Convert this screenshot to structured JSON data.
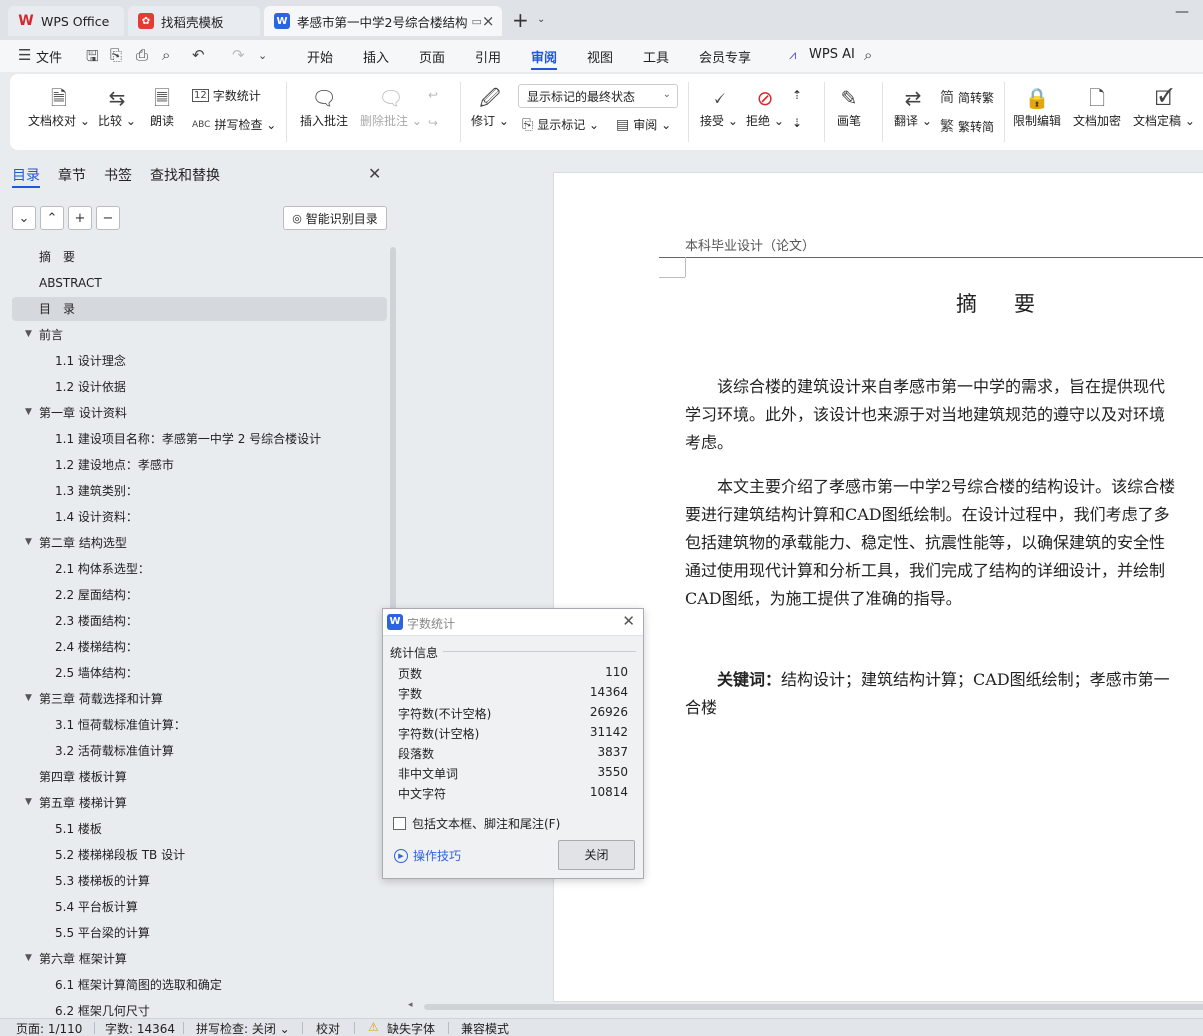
{
  "tabs": {
    "wps": "WPS Office",
    "template": "找稻壳模板",
    "doc": "孝感市第一中学2号综合楼结构"
  },
  "menubar": {
    "file": "文件",
    "items": [
      "开始",
      "插入",
      "页面",
      "引用",
      "审阅",
      "视图",
      "工具",
      "会员专享"
    ],
    "wps_ai": "WPS AI"
  },
  "ribbon": {
    "doc_check": "文档校对",
    "compare": "比较",
    "read_aloud": "朗读",
    "word_count": "字数统计",
    "spell_check": "拼写检查",
    "insert_comment": "插入批注",
    "delete_comment": "删除批注",
    "revise": "修订",
    "markup_select": "显示标记的最终状态",
    "show_markup": "显示标记",
    "review": "审阅",
    "accept": "接受",
    "reject": "拒绝",
    "pen": "画笔",
    "translate": "翻译",
    "to_trad": "简转繁",
    "to_simp": "繁转简",
    "restrict_edit": "限制编辑",
    "encrypt": "文档加密",
    "finalize": "文档定稿"
  },
  "panel": {
    "tabs": [
      "目录",
      "章节",
      "书签",
      "查找和替换"
    ],
    "smart_toc": "智能识别目录",
    "toc": [
      {
        "text": "摘　要",
        "level": 1,
        "expand": false,
        "selected": false
      },
      {
        "text": "ABSTRACT",
        "level": 1,
        "expand": false,
        "selected": false
      },
      {
        "text": "目　录",
        "level": 1,
        "expand": false,
        "selected": true
      },
      {
        "text": "前言",
        "level": 1,
        "expand": true,
        "selected": false
      },
      {
        "text": "1.1 设计理念",
        "level": 2,
        "expand": false,
        "selected": false
      },
      {
        "text": "1.2 设计依据",
        "level": 2,
        "expand": false,
        "selected": false
      },
      {
        "text": "第一章  设计资料",
        "level": 1,
        "expand": true,
        "selected": false
      },
      {
        "text": "1.1 建设项目名称：孝感第一中学 2 号综合楼设计",
        "level": 2,
        "expand": false,
        "selected": false
      },
      {
        "text": "1.2 建设地点：孝感市",
        "level": 2,
        "expand": false,
        "selected": false
      },
      {
        "text": "1.3 建筑类别：",
        "level": 2,
        "expand": false,
        "selected": false
      },
      {
        "text": "1.4 设计资料：",
        "level": 2,
        "expand": false,
        "selected": false
      },
      {
        "text": "第二章  结构选型",
        "level": 1,
        "expand": true,
        "selected": false
      },
      {
        "text": "2.1 构体系选型：",
        "level": 2,
        "expand": false,
        "selected": false
      },
      {
        "text": "2.2 屋面结构：",
        "level": 2,
        "expand": false,
        "selected": false
      },
      {
        "text": "2.3 楼面结构：",
        "level": 2,
        "expand": false,
        "selected": false
      },
      {
        "text": "2.4 楼梯结构：",
        "level": 2,
        "expand": false,
        "selected": false
      },
      {
        "text": "2.5 墙体结构：",
        "level": 2,
        "expand": false,
        "selected": false
      },
      {
        "text": "第三章  荷载选择和计算",
        "level": 1,
        "expand": true,
        "selected": false
      },
      {
        "text": "3.1 恒荷载标准值计算：",
        "level": 2,
        "expand": false,
        "selected": false
      },
      {
        "text": "3.2 活荷载标准值计算",
        "level": 2,
        "expand": false,
        "selected": false
      },
      {
        "text": "第四章  楼板计算",
        "level": 1,
        "expand": false,
        "selected": false
      },
      {
        "text": "第五章  楼梯计算",
        "level": 1,
        "expand": true,
        "selected": false
      },
      {
        "text": "5.1 楼板",
        "level": 2,
        "expand": false,
        "selected": false
      },
      {
        "text": "5.2 楼梯梯段板 TB 设计",
        "level": 2,
        "expand": false,
        "selected": false
      },
      {
        "text": "5.3 楼梯板的计算",
        "level": 2,
        "expand": false,
        "selected": false
      },
      {
        "text": "5.4 平台板计算",
        "level": 2,
        "expand": false,
        "selected": false
      },
      {
        "text": "5.5 平台梁的计算",
        "level": 2,
        "expand": false,
        "selected": false
      },
      {
        "text": "第六章  框架计算",
        "level": 1,
        "expand": true,
        "selected": false
      },
      {
        "text": "6.1 框架计算简图的选取和确定",
        "level": 2,
        "expand": false,
        "selected": false
      },
      {
        "text": "6.2 框架几何尺寸",
        "level": 2,
        "expand": false,
        "selected": false
      }
    ]
  },
  "document": {
    "header": "本科毕业设计（论文）",
    "title": "摘　要",
    "lines": [
      "　　该综合楼的建筑设计来自孝感市第一中学的需求，旨在提供现代",
      "学习环境。此外，该设计也来源于对当地建筑规范的遵守以及对环境",
      "考虑。",
      "　　本文主要介绍了孝感市第一中学2号综合楼的结构设计。该综合楼",
      "要进行建筑结构计算和CAD图纸绘制。在设计过程中，我们考虑了多",
      "包括建筑物的承载能力、稳定性、抗震性能等，以确保建筑的安全性",
      "通过使用现代计算和分析工具，我们完成了结构的详细设计，并绘制",
      "CAD图纸，为施工提供了准确的指导。"
    ],
    "keywords_label": "关键词：",
    "keywords": "结构设计；建筑结构计算；CAD图纸绘制；孝感市第一",
    "keywords_cont": "合楼"
  },
  "dialog": {
    "title": "字数统计",
    "group": "统计信息",
    "stats": [
      {
        "label": "页数",
        "value": "110"
      },
      {
        "label": "字数",
        "value": "14364"
      },
      {
        "label": "字符数(不计空格)",
        "value": "26926"
      },
      {
        "label": "字符数(计空格)",
        "value": "31142"
      },
      {
        "label": "段落数",
        "value": "3837"
      },
      {
        "label": "非中文单词",
        "value": "3550"
      },
      {
        "label": "中文字符",
        "value": "10814"
      }
    ],
    "include_label": "包括文本框、脚注和尾注(F)",
    "tips": "操作技巧",
    "close": "关闭"
  },
  "status": {
    "page": "页面: 1/110",
    "words": "字数: 14364",
    "spell": "拼写检查: 关闭",
    "proof": "校对",
    "missing_font": "缺失字体",
    "compat": "兼容模式"
  }
}
